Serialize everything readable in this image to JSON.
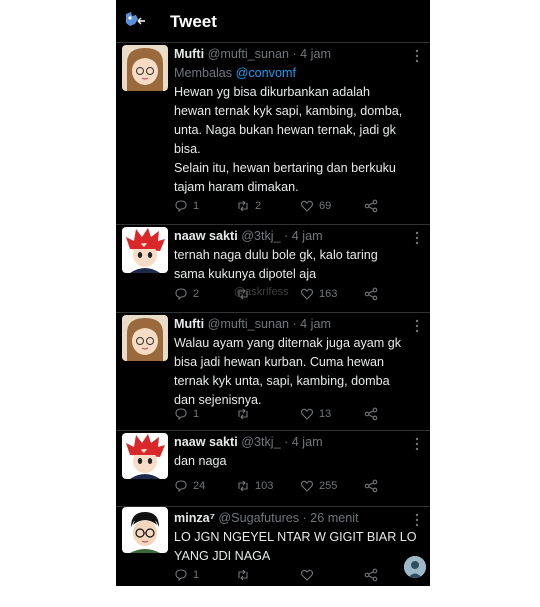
{
  "header": {
    "title": "Tweet"
  },
  "watermark": "@askrlfess",
  "tweets": [
    {
      "name": "Mufti",
      "handle": "@mufti_sunan",
      "time": "· 4 jam",
      "reply_prefix": "Membalas ",
      "reply_mention": "@convomf",
      "lines": [
        "Hewan yg bisa dikurbankan adalah",
        "hewan ternak kyk sapi, kambing, domba,",
        "unta. Naga bukan hewan ternak, jadi gk",
        "bisa.",
        "Selain itu, hewan bertaring dan berkuku",
        "tajam haram dimakan."
      ],
      "replies": "1",
      "retweets": "2",
      "likes": "69"
    },
    {
      "name": "naaw sakti",
      "handle": "@3tkj_",
      "time": "· 4 jam",
      "lines": [
        "ternah naga dulu bole gk, kalo taring",
        "sama kukunya dipotel aja"
      ],
      "replies": "2",
      "retweets": "",
      "likes": "163"
    },
    {
      "name": "Mufti",
      "handle": "@mufti_sunan",
      "time": "· 4 jam",
      "lines": [
        "Walau ayam yang diternak juga ayam gk",
        "bisa jadi hewan kurban. Cuma hewan",
        "ternak kyk unta, sapi, kambing, domba",
        "dan sejenisnya."
      ],
      "replies": "1",
      "retweets": "",
      "likes": "13"
    },
    {
      "name": "naaw sakti",
      "handle": "@3tkj_",
      "time": "· 4 jam",
      "lines": [
        "dan naga"
      ],
      "replies": "24",
      "retweets": "103",
      "likes": "255"
    },
    {
      "name": "minza⁷",
      "handle": "@Sugafutures",
      "time": "· 26 menit",
      "lines": [
        "LO JGN NGEYEL NTAR W GIGIT BIAR LO",
        "YANG JDI NAGA"
      ],
      "replies": "1",
      "retweets": "",
      "likes": ""
    }
  ]
}
